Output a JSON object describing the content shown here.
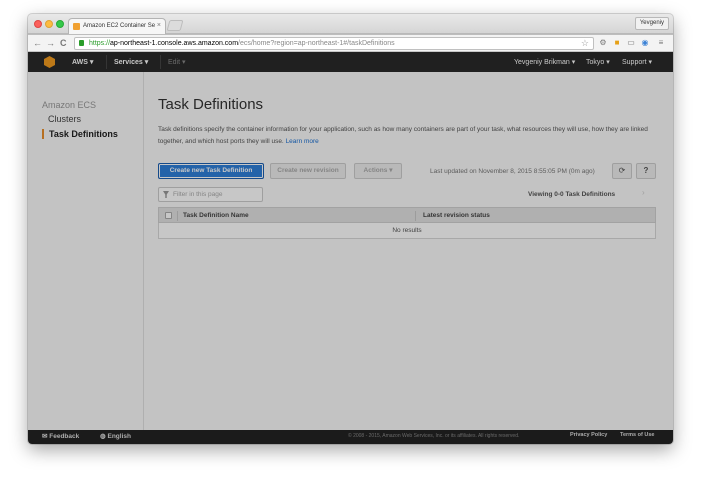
{
  "browser": {
    "tab_title": "Amazon EC2 Container Se",
    "tab_close": "×",
    "profile_name": "Yevgeniy",
    "url_scheme": "https://",
    "url_domain": "ap-northeast-1.console.aws.amazon.com",
    "url_path": "/ecs/home?region=ap-northeast-1#/taskDefinitions",
    "back": "←",
    "forward": "→",
    "reload": "C"
  },
  "aws_nav": {
    "aws_label": "AWS",
    "services_label": "Services",
    "edit_label": "Edit",
    "user_label": "Yevgeniy Brikman",
    "region_label": "Tokyo",
    "support_label": "Support",
    "caret": "▾"
  },
  "sidebar": {
    "title": "Amazon ECS",
    "items": [
      {
        "label": "Clusters",
        "active": false
      },
      {
        "label": "Task Definitions",
        "active": true
      }
    ]
  },
  "main": {
    "title": "Task Definitions",
    "description": "Task definitions specify the container information for your application, such as how many containers are part of your task, what resources they will use, how they are linked together, and which host ports they will use.",
    "learn_more": "Learn more",
    "create_button": "Create new Task Definition",
    "revision_button": "Create new revision",
    "actions_button": "Actions",
    "last_updated": "Last updated on November 8, 2015 8:55:05 PM (0m ago)",
    "refresh_icon": "⟳",
    "help_icon": "?",
    "filter_placeholder": "Filter in this page",
    "viewing": "Viewing 0-0 Task Definitions",
    "viewing_arrow": "›",
    "table": {
      "columns": [
        "Task Definition Name",
        "Latest revision status"
      ],
      "empty": "No results"
    }
  },
  "footer": {
    "feedback": "Feedback",
    "language": "English",
    "copyright": "© 2008 - 2015, Amazon Web Services, Inc. or its affiliates. All rights reserved.",
    "privacy": "Privacy Policy",
    "terms": "Terms of Use"
  },
  "colors": {
    "primary_button": "#2f7fd9",
    "nav_bg": "#2a2a2a",
    "active_marker": "#e98f2b",
    "link": "#1a6fd1"
  }
}
